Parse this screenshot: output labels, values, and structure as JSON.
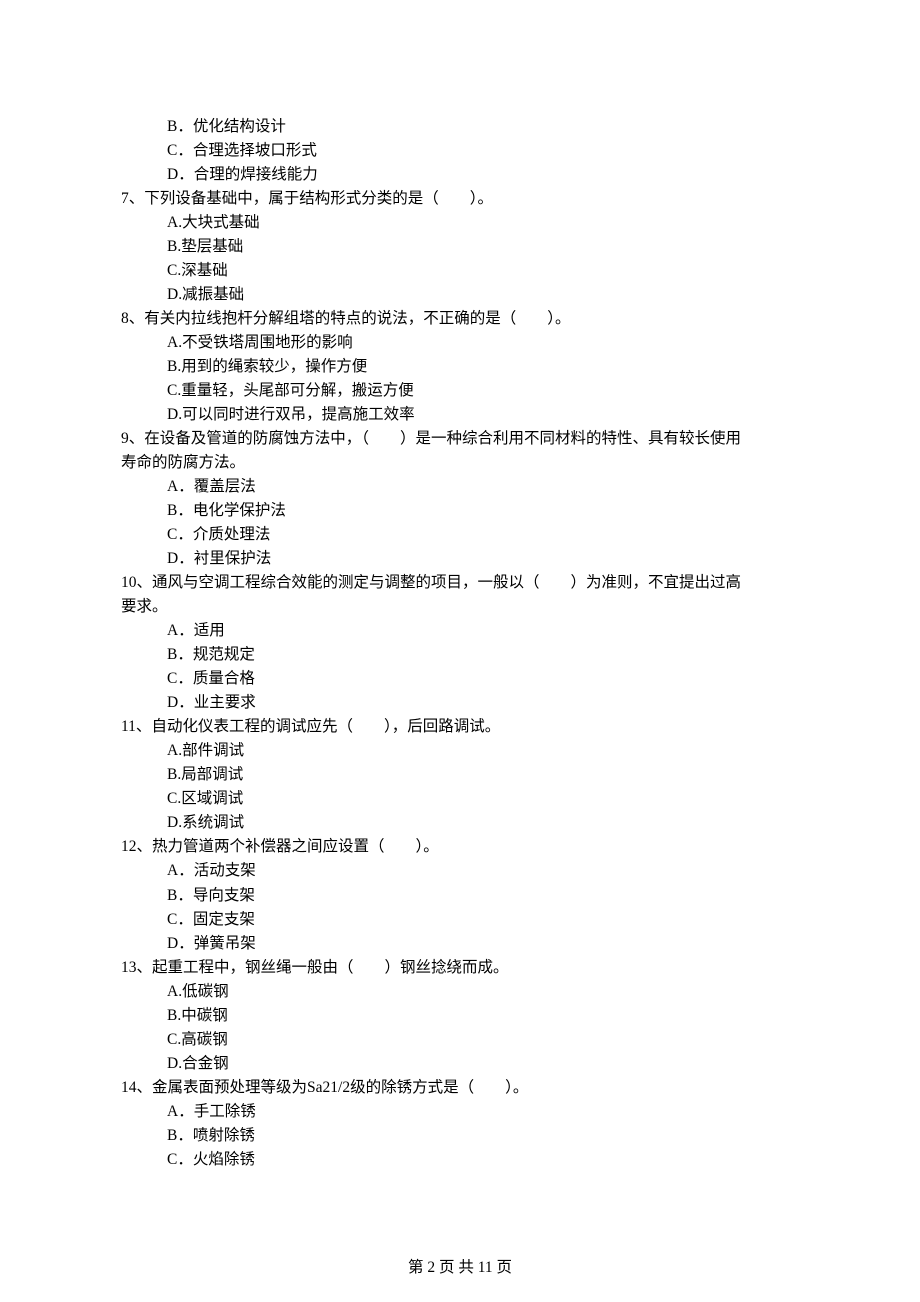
{
  "questions": [
    {
      "number": "",
      "stem_cont": "",
      "options": [
        {
          "label": "B．",
          "text": "优化结构设计"
        },
        {
          "label": "C．",
          "text": "合理选择坡口形式"
        },
        {
          "label": "D．",
          "text": "合理的焊接线能力"
        }
      ]
    },
    {
      "number": "7、",
      "stem": "下列设备基础中，属于结构形式分类的是（　　）。",
      "options": [
        {
          "label": "A.",
          "text": "大块式基础"
        },
        {
          "label": "B.",
          "text": "垫层基础"
        },
        {
          "label": "C.",
          "text": "深基础"
        },
        {
          "label": "D.",
          "text": "减振基础"
        }
      ]
    },
    {
      "number": "8、",
      "stem": "有关内拉线抱杆分解组塔的特点的说法，不正确的是（　　）。",
      "options": [
        {
          "label": "A.",
          "text": "不受铁塔周围地形的影响"
        },
        {
          "label": "B.",
          "text": "用到的绳索较少，操作方便"
        },
        {
          "label": "C.",
          "text": "重量轻，头尾部可分解，搬运方便"
        },
        {
          "label": "D.",
          "text": "可以同时进行双吊，提高施工效率"
        }
      ]
    },
    {
      "number": "9、",
      "stem": "在设备及管道的防腐蚀方法中，（　　）是一种综合利用不同材料的特性、具有较长使用",
      "stem_cont": "寿命的防腐方法。",
      "options": [
        {
          "label": "A．",
          "text": "覆盖层法"
        },
        {
          "label": "B．",
          "text": "电化学保护法"
        },
        {
          "label": "C．",
          "text": "介质处理法"
        },
        {
          "label": "D．",
          "text": "衬里保护法"
        }
      ]
    },
    {
      "number": "10、",
      "stem": "通风与空调工程综合效能的测定与调整的项目，一般以（　　）为准则，不宜提出过高",
      "stem_cont": "要求。",
      "options": [
        {
          "label": "A．",
          "text": "适用"
        },
        {
          "label": "B．",
          "text": "规范规定"
        },
        {
          "label": "C．",
          "text": "质量合格"
        },
        {
          "label": "D．",
          "text": "业主要求"
        }
      ]
    },
    {
      "number": "11、",
      "stem": "自动化仪表工程的调试应先（　　），后回路调试。",
      "options": [
        {
          "label": "A.",
          "text": "部件调试"
        },
        {
          "label": "B.",
          "text": "局部调试"
        },
        {
          "label": "C.",
          "text": "区域调试"
        },
        {
          "label": "D.",
          "text": "系统调试"
        }
      ]
    },
    {
      "number": "12、",
      "stem": "热力管道两个补偿器之间应设置（　　）。",
      "options": [
        {
          "label": "A．",
          "text": "活动支架"
        },
        {
          "label": "B．",
          "text": "导向支架"
        },
        {
          "label": "C．",
          "text": "固定支架"
        },
        {
          "label": "D．",
          "text": "弹簧吊架"
        }
      ]
    },
    {
      "number": "13、",
      "stem": "起重工程中，钢丝绳一般由（　　）钢丝捻绕而成。",
      "options": [
        {
          "label": "A.",
          "text": "低碳钢"
        },
        {
          "label": "B.",
          "text": "中碳钢"
        },
        {
          "label": "C.",
          "text": "高碳钢"
        },
        {
          "label": "D.",
          "text": "合金钢"
        }
      ]
    },
    {
      "number": "14、",
      "stem": "金属表面预处理等级为Sa21/2级的除锈方式是（　　）。",
      "options": [
        {
          "label": "A．",
          "text": "手工除锈"
        },
        {
          "label": "B．",
          "text": "喷射除锈"
        },
        {
          "label": "C．",
          "text": "火焰除锈"
        }
      ]
    }
  ],
  "footer": "第 2 页 共 11 页"
}
